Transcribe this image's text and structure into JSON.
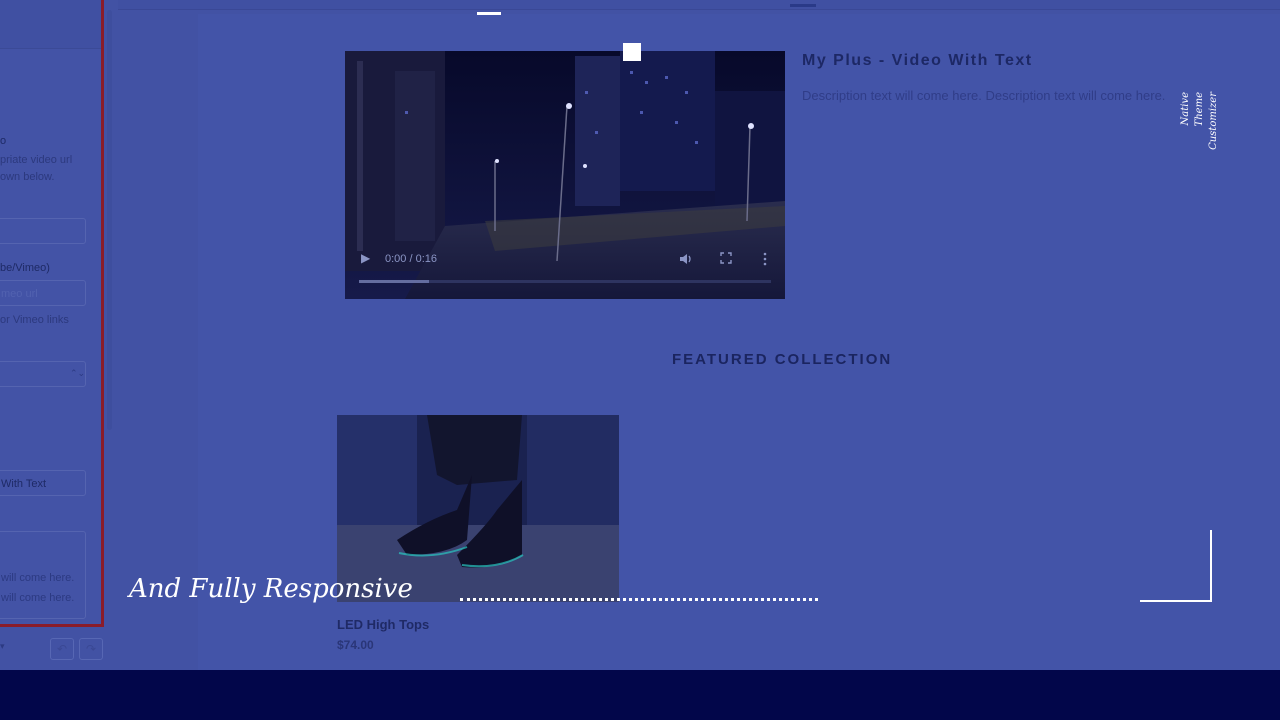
{
  "sidebar": {
    "video_help_heading": "o",
    "video_help_line1": "priate video url",
    "video_help_line2": "own below.",
    "video_url_label": "be/Vimeo)",
    "video_url_placeholder": "meo url",
    "video_url_hint": "or Vimeo links",
    "select_caret": "⌃⌄",
    "heading_value": "With Text",
    "desc_line1": "will come here.",
    "desc_line2": "will come here.",
    "device_caret": "▾",
    "undo_icon": "↶",
    "redo_icon": "↷"
  },
  "video": {
    "time": "0:00 / 0:16",
    "progress": 0.17,
    "title": "My Plus - Video With Text",
    "description": "Description text will come here. Description text will come here."
  },
  "featured": {
    "title": "FEATURED COLLECTION",
    "products": [
      {
        "name": "LED High Tops",
        "price": "$74.00"
      }
    ]
  },
  "overlay": {
    "caption": "And Fully Responsive",
    "side_text": [
      "Native",
      "Theme",
      "Customizer"
    ]
  },
  "colors": {
    "tint": "#4252a4",
    "panel_border": "#8a1c2a",
    "footer_band": "#02064a"
  },
  "icons": {
    "play": "play-icon",
    "volume": "volume-icon",
    "fullscreen": "fullscreen-icon",
    "more": "more-options-icon"
  }
}
